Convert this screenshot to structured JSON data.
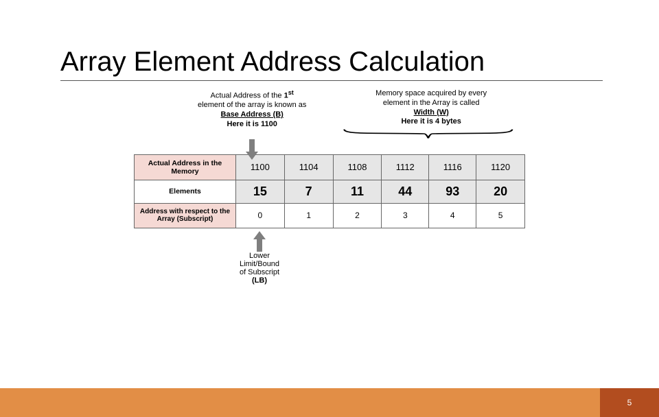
{
  "slide": {
    "title": "Array Element Address Calculation",
    "page_number": "5"
  },
  "annotations": {
    "left": {
      "line1_pre": "Actual Address of the ",
      "line1_bold": "1",
      "line1_sup": "st",
      "line2": "element of the array is known as",
      "term": "Base Address (B)",
      "here": "Here it is 1100"
    },
    "right": {
      "line1": "Memory space acquired by every",
      "line2": "element in the Array is called",
      "term": "Width (W)",
      "here": "Here it is 4 bytes"
    },
    "bottom": {
      "line1": "Lower Limit/Bound",
      "line2_pre": "of Subscript ",
      "line2_bold": "(LB)"
    }
  },
  "table": {
    "row_headers": {
      "addr": "Actual Address in the Memory",
      "elem": "Elements",
      "sub": "Address with respect to the Array (Subscript)"
    },
    "addresses": [
      "1100",
      "1104",
      "1108",
      "1112",
      "1116",
      "1120"
    ],
    "elements": [
      "15",
      "7",
      "11",
      "44",
      "93",
      "20"
    ],
    "subscripts": [
      "0",
      "1",
      "2",
      "3",
      "4",
      "5"
    ]
  },
  "chart_data": {
    "type": "table",
    "title": "Array Element Address Calculation",
    "columns": [
      "Actual Address in the Memory",
      "Elements",
      "Address with respect to the Array (Subscript)"
    ],
    "rows": [
      {
        "address": 1100,
        "element": 15,
        "subscript": 0
      },
      {
        "address": 1104,
        "element": 7,
        "subscript": 1
      },
      {
        "address": 1108,
        "element": 11,
        "subscript": 2
      },
      {
        "address": 1112,
        "element": 44,
        "subscript": 3
      },
      {
        "address": 1116,
        "element": 93,
        "subscript": 4
      },
      {
        "address": 1120,
        "element": 20,
        "subscript": 5
      }
    ],
    "base_address": 1100,
    "width_bytes": 4,
    "lower_bound": 0
  }
}
